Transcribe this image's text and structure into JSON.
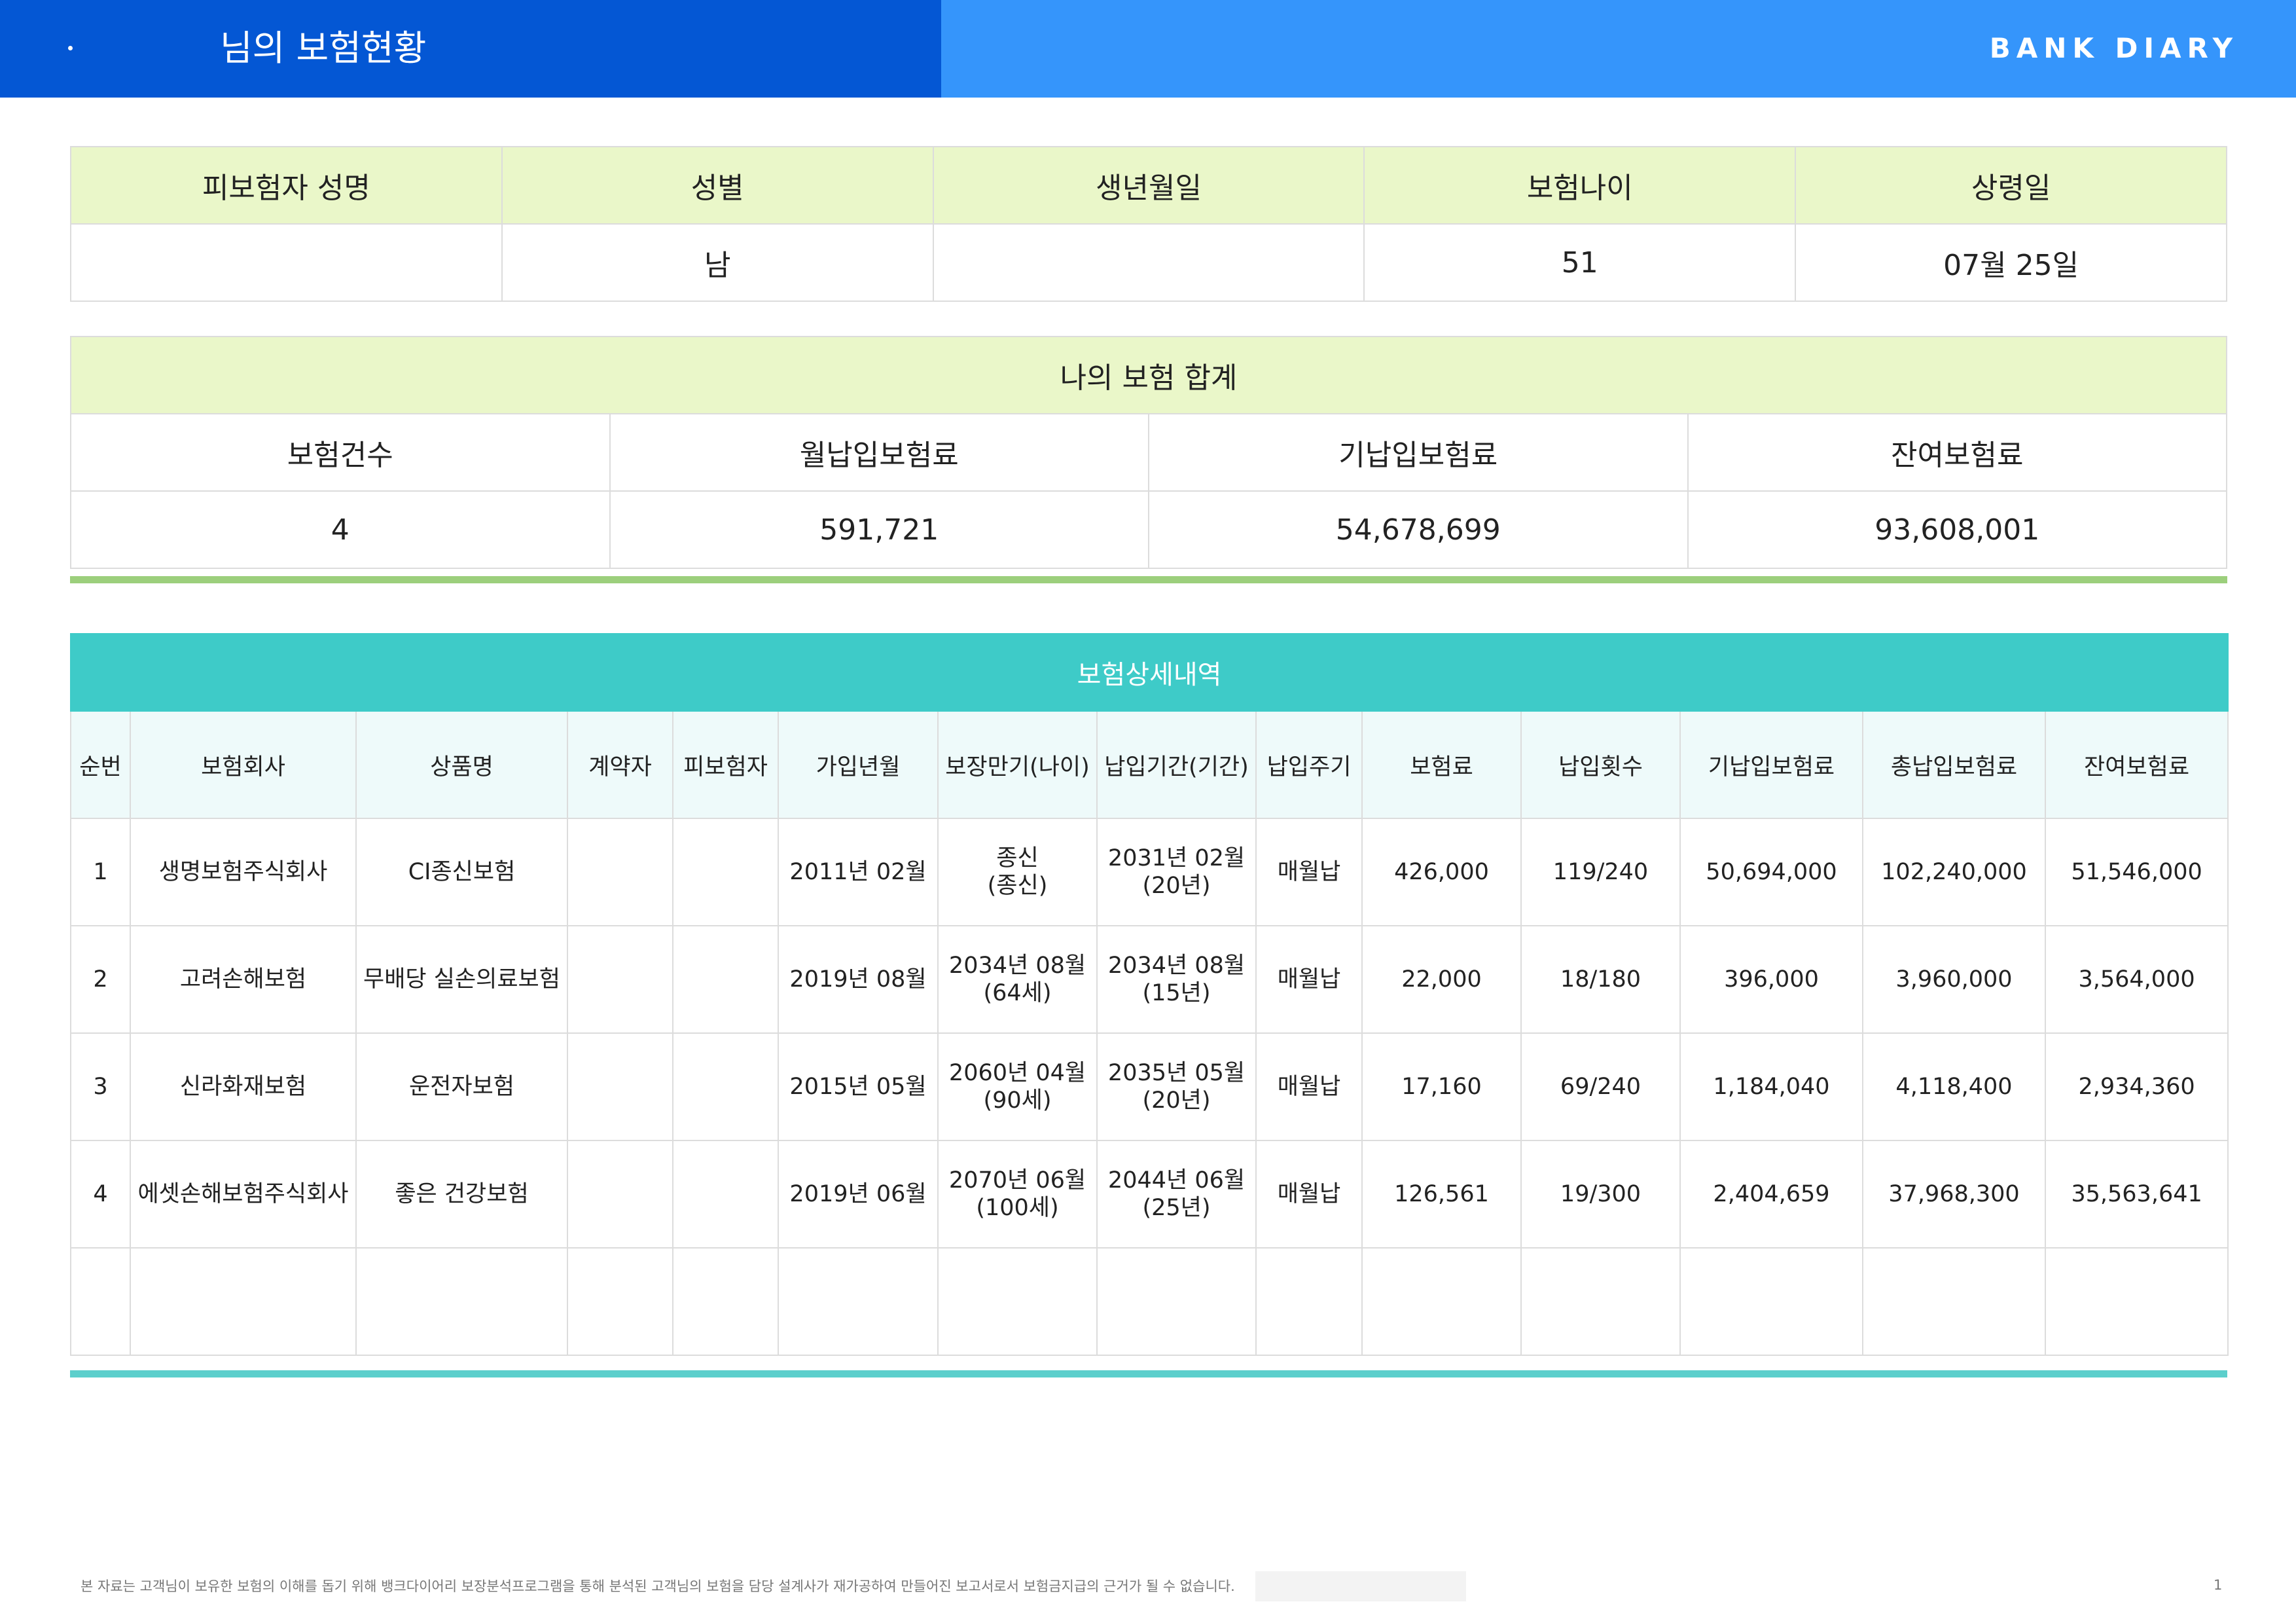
{
  "header": {
    "title": "님의 보험현황",
    "logo_text": "BANK DIARY",
    "left_color": "#0457d4",
    "right_color": "#3595fb"
  },
  "insured_info": {
    "headers": [
      "피보험자 성명",
      "성별",
      "생년월일",
      "보험나이",
      "상령일"
    ],
    "values": [
      "",
      "남",
      "",
      "51",
      "07월 25일"
    ]
  },
  "summary": {
    "title": "나의 보험 합계",
    "headers": [
      "보험건수",
      "월납입보험료",
      "기납입보험료",
      "잔여보험료"
    ],
    "values": [
      "4",
      "591,721",
      "54,678,699",
      "93,608,001"
    ]
  },
  "detail": {
    "title": "보험상세내역",
    "headers": [
      "순번",
      "보험회사",
      "상품명",
      "계약자",
      "피보험자",
      "가입년월",
      "보장만기(나이)",
      "납입기간(기간)",
      "납입주기",
      "보험료",
      "납입횟수",
      "기납입보험료",
      "총납입보험료",
      "잔여보험료"
    ],
    "rows": [
      {
        "no": "1",
        "company": "생명보험주식회사",
        "product": "CI종신보험",
        "contractor": "",
        "insured": "",
        "join_date": "2011년 02월",
        "maturity": "종신",
        "maturity_age": "(종신)",
        "pay_period": "2031년 02월",
        "pay_years": "(20년)",
        "cycle": "매월납",
        "premium": "426,000",
        "count": "119/240",
        "paid": "50,694,000",
        "total": "102,240,000",
        "remaining": "51,546,000"
      },
      {
        "no": "2",
        "company": "고려손해보험",
        "product": "무배당 실손의료보험",
        "contractor": "",
        "insured": "",
        "join_date": "2019년 08월",
        "maturity": "2034년 08월",
        "maturity_age": "(64세)",
        "pay_period": "2034년 08월",
        "pay_years": "(15년)",
        "cycle": "매월납",
        "premium": "22,000",
        "count": "18/180",
        "paid": "396,000",
        "total": "3,960,000",
        "remaining": "3,564,000"
      },
      {
        "no": "3",
        "company": "신라화재보험",
        "product": "운전자보험",
        "contractor": "",
        "insured": "",
        "join_date": "2015년 05월",
        "maturity": "2060년 04월",
        "maturity_age": "(90세)",
        "pay_period": "2035년 05월",
        "pay_years": "(20년)",
        "cycle": "매월납",
        "premium": "17,160",
        "count": "69/240",
        "paid": "1,184,040",
        "total": "4,118,400",
        "remaining": "2,934,360"
      },
      {
        "no": "4",
        "company": "에셋손해보험주식회사",
        "product": "좋은 건강보험",
        "contractor": "",
        "insured": "",
        "join_date": "2019년 06월",
        "maturity": "2070년 06월",
        "maturity_age": "(100세)",
        "pay_period": "2044년 06월",
        "pay_years": "(25년)",
        "cycle": "매월납",
        "premium": "126,561",
        "count": "19/300",
        "paid": "2,404,659",
        "total": "37,968,300",
        "remaining": "35,563,641"
      }
    ]
  },
  "footer": {
    "note": "본 자료는 고객님이 보유한 보험의 이해를 돕기 위해 뱅크다이어리 보장분석프로그램을 통해 분석된 고객님의 보험을 담당 설계사가 재가공하여 만들어진 보고서로서 보험금지급의 근거가 될 수 없습니다.",
    "page_number": "1"
  }
}
